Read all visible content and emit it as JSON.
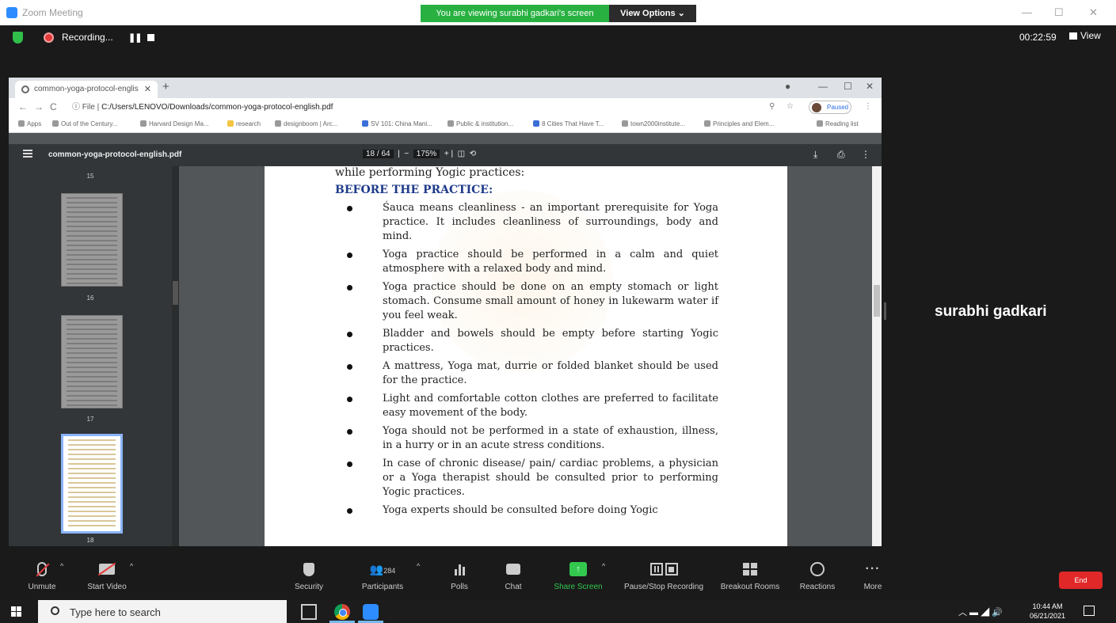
{
  "zoom": {
    "window_title": "Zoom Meeting",
    "viewing_banner": "You are viewing surabhi gadkari's screen",
    "view_options": "View Options ⌄",
    "recording_label": "Recording...",
    "timer": "00:22:59",
    "view_label": "View",
    "participant_name": "surabhi gadkari"
  },
  "browser": {
    "tab_title": "common-yoga-protocol-englis",
    "url_prefix": "File | ",
    "url_path": "C:/Users/LENOVO/Downloads/common-yoga-protocol-english.pdf",
    "profile_label": "Paused",
    "bookmarks": [
      "Apps",
      "Out of the Century...",
      "Harvard Design Ma...",
      "research",
      "designboom | Arc...",
      "SV 101: China Mani...",
      "Public & institution...",
      "8 Cities That Have T...",
      "town2000institute...",
      "Principles and Elem...",
      "Reading list"
    ]
  },
  "pdf": {
    "filename": "common-yoga-protocol-english.pdf",
    "page_indicator": "18 / 64",
    "zoom_level": "175%",
    "thumbnail_numbers": [
      "15",
      "16",
      "17",
      "18"
    ],
    "intro_line": "while performing Yogic practices:",
    "heading": "BEFORE THE PRACTICE:",
    "bullets": [
      "Śauca means cleanliness - an important prerequisite for Yoga practice. It includes cleanliness of surroundings, body and mind.",
      "Yoga practice should be performed in a calm and quiet atmosphere with a relaxed body and mind.",
      "Yoga practice should be done on an empty stomach or light stomach. Consume small amount of honey in lukewarm water if you feel weak.",
      "Bladder and bowels should be empty before starting Yogic practices.",
      "A mattress, Yoga mat, durrie or folded blanket should be used for the practice.",
      "Light and comfortable cotton clothes are preferred to facilitate easy movement of the body.",
      "Yoga should not be performed in a state of exhaustion, illness, in a hurry or in an acute stress conditions.",
      "In case of chronic disease/ pain/ cardiac problems, a physician or a Yoga therapist should be consulted prior to performing Yogic practices.",
      "Yoga experts should be consulted before doing Yogic"
    ]
  },
  "controls": {
    "unmute": "Unmute",
    "start_video": "Start Video",
    "security": "Security",
    "participants": "Participants",
    "participant_count": "284",
    "polls": "Polls",
    "chat": "Chat",
    "share_screen": "Share Screen",
    "pause_recording": "Pause/Stop Recording",
    "breakout_rooms": "Breakout Rooms",
    "reactions": "Reactions",
    "more": "More",
    "end": "End"
  },
  "taskbar": {
    "search_placeholder": "Type here to search",
    "time": "10:44 AM",
    "date": "06/21/2021"
  },
  "colors": {
    "banner_green": "#28b141",
    "end_red": "#e02828",
    "share_green": "#32c94e",
    "heading_blue": "#1f3b8a"
  }
}
